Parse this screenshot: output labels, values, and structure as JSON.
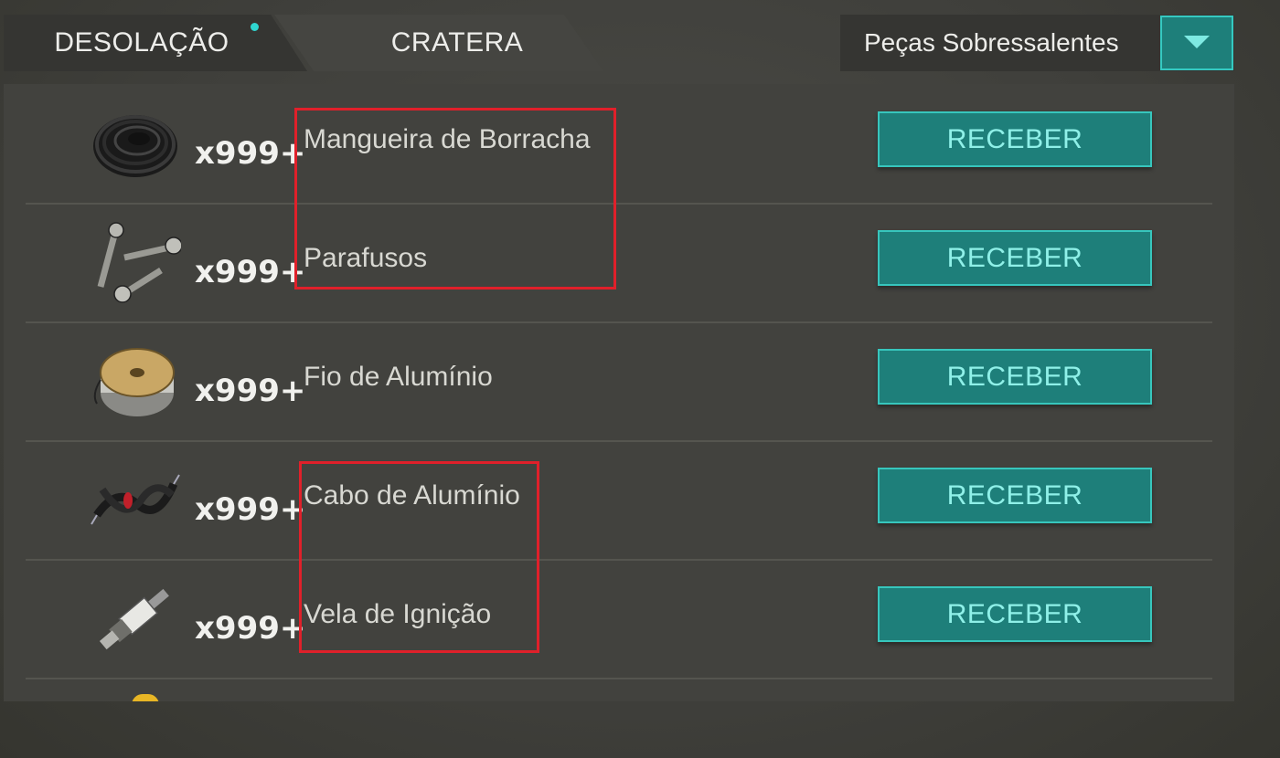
{
  "tabs": [
    {
      "label": "DESOLAÇÃO",
      "active": true,
      "has_notification_dot": true
    },
    {
      "label": "CRATERA",
      "active": false
    }
  ],
  "filter": {
    "selected": "Peças Sobressalentes",
    "icon": "chevron-down-icon"
  },
  "items": [
    {
      "name": "Mangueira de Borracha",
      "quantity": "x999+",
      "icon": "rubber-hose-icon",
      "button": "RECEBER"
    },
    {
      "name": "Parafusos",
      "quantity": "x999+",
      "icon": "screws-icon",
      "button": "RECEBER"
    },
    {
      "name": "Fio de Alumínio",
      "quantity": "x999+",
      "icon": "wire-spool-icon",
      "button": "RECEBER"
    },
    {
      "name": "Cabo de Alumínio",
      "quantity": "x999+",
      "icon": "cable-icon",
      "button": "RECEBER"
    },
    {
      "name": "Vela de Ignição",
      "quantity": "x999+",
      "icon": "spark-plug-icon",
      "button": "RECEBER"
    }
  ],
  "colors": {
    "accent": "#1e7f7a",
    "accent_border": "#37c6bd",
    "button_text": "#8ff0e8",
    "annotation": "#e0202a"
  }
}
